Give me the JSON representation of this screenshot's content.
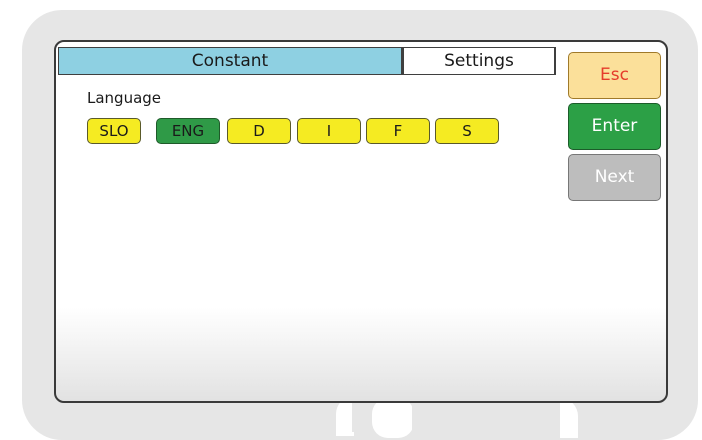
{
  "tabs": {
    "constant": "Constant",
    "settings": "Settings"
  },
  "language": {
    "label": "Language",
    "options": [
      "SLO",
      "ENG",
      "D",
      "I",
      "F",
      "S"
    ],
    "selected": "ENG"
  },
  "side_buttons": {
    "esc": "Esc",
    "enter": "Enter",
    "next": "Next"
  },
  "colors": {
    "tab_active": "#8ed0e2",
    "option_default": "#f5eb22",
    "option_selected": "#2f9a47",
    "esc_bg": "#fbe09a",
    "esc_text": "#e53b2a",
    "enter_bg": "#2ca046",
    "next_bg": "#bdbdbd"
  }
}
